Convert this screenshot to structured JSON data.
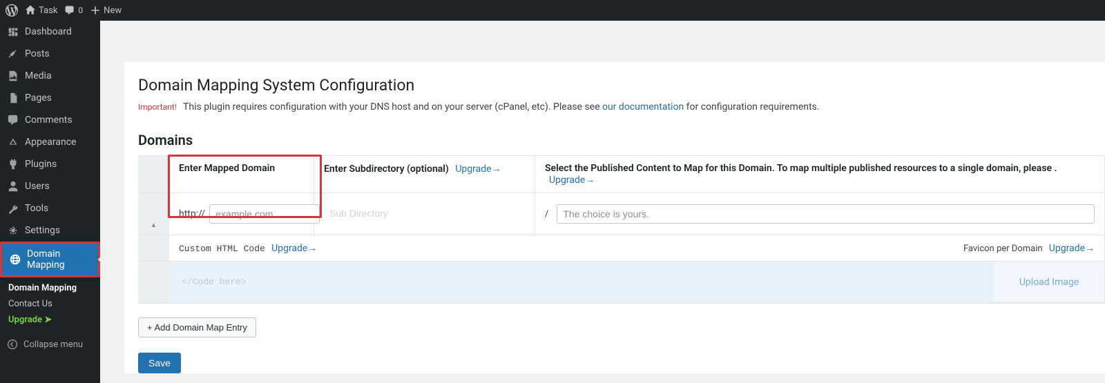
{
  "adminbar": {
    "site_name": "Task",
    "comments_count": "0",
    "new_label": "New"
  },
  "sidebar": {
    "items": [
      {
        "label": "Dashboard"
      },
      {
        "label": "Posts"
      },
      {
        "label": "Media"
      },
      {
        "label": "Pages"
      },
      {
        "label": "Comments"
      },
      {
        "label": "Appearance"
      },
      {
        "label": "Plugins"
      },
      {
        "label": "Users"
      },
      {
        "label": "Tools"
      },
      {
        "label": "Settings"
      },
      {
        "label": "Domain Mapping"
      }
    ],
    "submenu": {
      "item0": "Domain Mapping",
      "item1": "Contact Us",
      "item2": "Upgrade  ➤"
    },
    "collapse": "Collapse menu"
  },
  "page": {
    "title": "Domain Mapping System Configuration",
    "important_label": "Important!",
    "notice_pre": "This plugin requires configuration with your DNS host and on your server (cPanel, etc). Please see ",
    "notice_link": "our documentation",
    "notice_post": " for configuration requirements.",
    "domains_heading": "Domains"
  },
  "table": {
    "col1_head": "Enter Mapped Domain",
    "col2_head": "Enter Subdirectory (optional)",
    "col2_upgrade": "Upgrade→",
    "col3_head": "Select the Published Content to Map for this Domain. To map multiple published resources to a single domain, please .",
    "col3_upgrade": "Upgrade→",
    "prefix": "http://",
    "domain_placeholder": "example.com",
    "subdir_placeholder": "Sub Directory",
    "slash": "/",
    "choice_placeholder": "The choice is yours.",
    "custom_code_label": "Custom HTML Code",
    "custom_code_upgrade": "Upgrade→",
    "favicon_label": "Favicon per Domain",
    "favicon_upgrade": "Upgrade→",
    "code_placeholder": "</Code here>",
    "upload_label": "Upload Image"
  },
  "buttons": {
    "add": "+ Add Domain Map Entry",
    "save": "Save"
  }
}
